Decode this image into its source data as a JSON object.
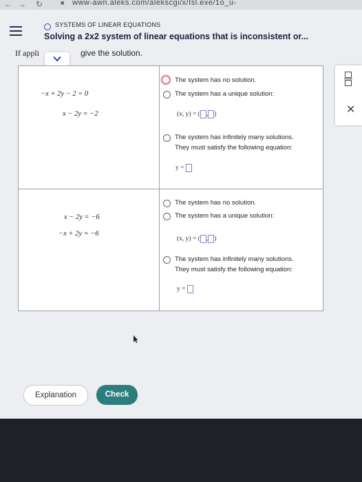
{
  "browser": {
    "url_partial": "www-awn.aleks.com/alekscgi/x/Isl.exe/1o_u-"
  },
  "header": {
    "topic": "SYSTEMS OF LINEAR EQUATIONS",
    "title": "Solving a 2x2 system of linear equations that is inconsistent or..."
  },
  "prompt": {
    "start": "If appli",
    "rest": "give the solution."
  },
  "system1": {
    "eq1": "−x + 2y − 2  =  0",
    "eq2": "x − 2y  =  −2",
    "options": {
      "no_solution": "The system has no solution.",
      "unique": "The system has a unique solution:",
      "unique_answer_prefix": "(x, y) = (",
      "infinite_line1": "The system has infinitely many solutions.",
      "infinite_line2": "They must satisfy the following equation:",
      "infinite_answer_prefix": "y ="
    },
    "selected": "no_solution"
  },
  "system2": {
    "eq1": "x − 2y  =  −6",
    "eq2": "−x + 2y  =  −6",
    "options": {
      "no_solution": "The system has no solution.",
      "unique": "The system has a unique solution:",
      "unique_answer_prefix": "(x, y) = (",
      "infinite_line1": "The system has infinitely many solutions.",
      "infinite_line2": "They must satisfy the following equation:",
      "infinite_answer_prefix": "y ="
    },
    "selected": null
  },
  "buttons": {
    "explanation": "Explanation",
    "check": "Check"
  },
  "icons": {
    "menu": "hamburger-icon",
    "expand": "chevron-down-icon",
    "fraction": "fraction-icon",
    "close": "close-icon"
  },
  "colors": {
    "accent": "#2e7d7d",
    "title": "#1d2240",
    "selected_radio": "#c94a63"
  }
}
